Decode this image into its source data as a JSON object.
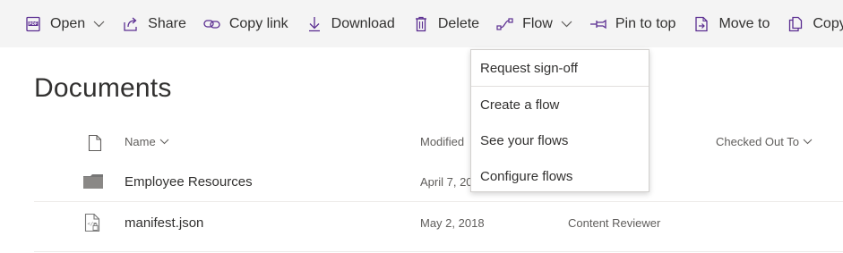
{
  "toolbar": {
    "open_label": "Open",
    "share_label": "Share",
    "copy_link_label": "Copy link",
    "download_label": "Download",
    "delete_label": "Delete",
    "flow_label": "Flow",
    "pin_label": "Pin to top",
    "move_label": "Move to",
    "copy_to_label": "Copy to"
  },
  "page": {
    "title": "Documents"
  },
  "list": {
    "columns": {
      "name": "Name",
      "modified": "Modified",
      "checked_out_to": "Checked Out To"
    },
    "rows": [
      {
        "name": "Employee Resources",
        "modified": "April 7, 20",
        "modified_by": "",
        "type": "folder"
      },
      {
        "name": "manifest.json",
        "modified": "May 2, 2018",
        "modified_by": "Content Reviewer",
        "type": "code-file"
      }
    ]
  },
  "flow_menu": {
    "items": [
      {
        "label": "Request sign-off"
      },
      {
        "label": "Create a flow"
      },
      {
        "label": "See your flows"
      },
      {
        "label": "Configure flows"
      }
    ]
  },
  "colors": {
    "accent": "#5b2e91",
    "command_bar_bg": "#f4f4f4",
    "folder": "#767676"
  }
}
